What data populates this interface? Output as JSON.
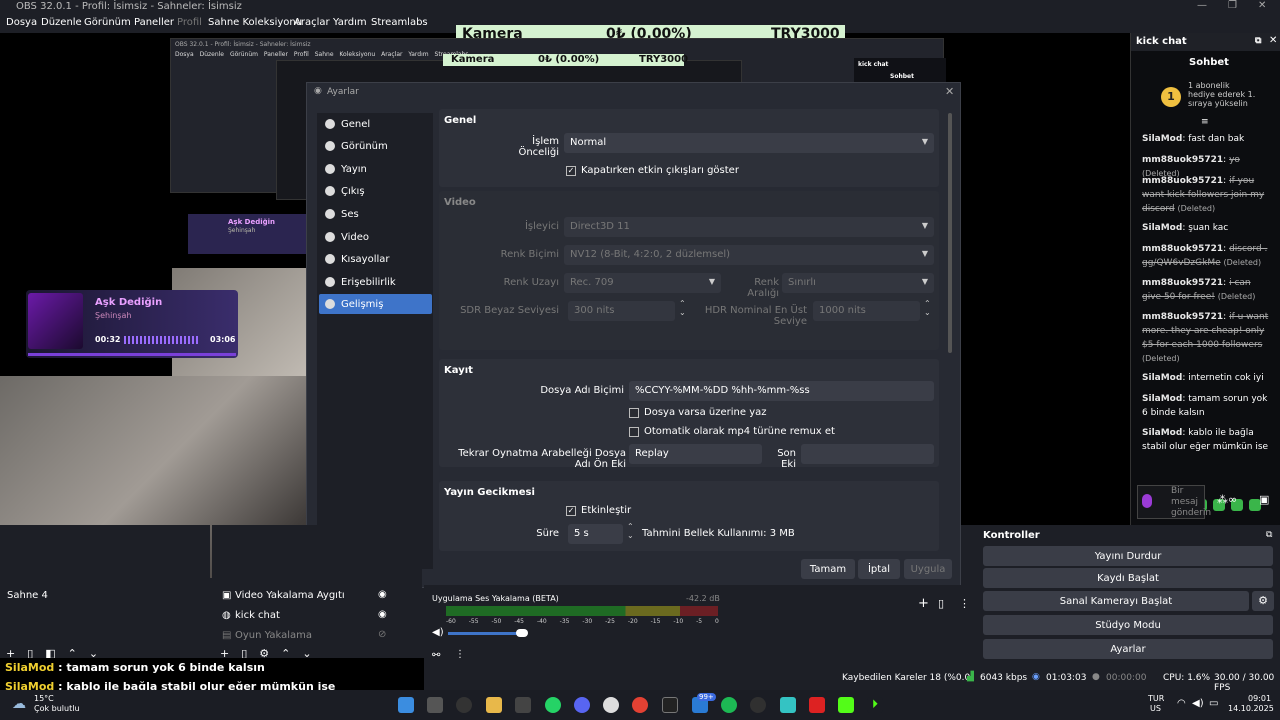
{
  "window": {
    "title": "OBS 32.0.1 - Profil: İsimsiz - Sahneler: İsimsiz",
    "minimize": "—",
    "restore": "❐",
    "close": "✕"
  },
  "menu": [
    "Dosya",
    "Düzenle",
    "Görünüm",
    "Paneller",
    "Profil",
    "Sahne Koleksiyonu",
    "Araçlar",
    "Yardım",
    "Streamlabs"
  ],
  "preview": {
    "banner_left": "Kamera",
    "banner_mid": "0₺ (0.00%)",
    "banner_right": "TRY3000",
    "inner_title": "OBS 32.0.1 - Profil: İsimsiz - Sahneler: İsimsiz",
    "inner_menu": [
      "Dosya",
      "Düzenle",
      "Görünüm",
      "Paneller",
      "Profil",
      "Sahne Koleksiyonu",
      "Araçlar",
      "Yardım",
      "Streamlabs"
    ],
    "inner_chat_title": "kick chat",
    "inner_chat_tab": "Sohbet",
    "music_title": "Aşk Dediğin",
    "music_artist": "Şehinşah",
    "music_time_start": "00:32",
    "music_time_end": "03:06"
  },
  "chat": {
    "title": "kick chat",
    "tab": "Sohbet",
    "gift": "1 abonelik hediye ederek 1. sıraya yükselin",
    "messages": [
      {
        "user": "SilaMod",
        "text": "fast dan bak",
        "deleted": false
      },
      {
        "user": "mm88uok95721",
        "text": "yo",
        "deleted": true
      },
      {
        "user": "mm88uok95721",
        "text": "if you want kick followers join my discord",
        "deleted": true
      },
      {
        "user": "SilaMod",
        "text": "şuan kac",
        "deleted": false
      },
      {
        "user": "mm88uok95721",
        "text": "discord . gg/QW6vDzGkMe",
        "deleted": true
      },
      {
        "user": "mm88uok95721",
        "text": "i can give 50 for free!",
        "deleted": true
      },
      {
        "user": "mm88uok95721",
        "text": "if u want more. they are cheap! only $5 for each 1000 followers",
        "deleted": true
      },
      {
        "user": "SilaMod",
        "text": "internetin cok iyi",
        "deleted": false
      },
      {
        "user": "SilaMod",
        "text": "tamam sorun yok 6 binde kalsın",
        "deleted": false
      },
      {
        "user": "SilaMod",
        "text": "kablo ile bağla stabil olur eğer mümkün ise",
        "deleted": false
      }
    ],
    "deleted_note": "(Deleted)",
    "input_placeholder": "Bir mesaj gönderin"
  },
  "settings": {
    "title": "Ayarlar",
    "nav": [
      "Genel",
      "Görünüm",
      "Yayın",
      "Çıkış",
      "Ses",
      "Video",
      "Kısayollar",
      "Erişebilirlik",
      "Gelişmiş"
    ],
    "selected": "Gelişmiş",
    "genel": {
      "header": "Genel",
      "priority_label": "İşlem Önceliği",
      "priority_value": "Normal",
      "show_outputs": "Kapatırken etkin çıkışları göster"
    },
    "video": {
      "header": "Video",
      "renderer_label": "İşleyici",
      "renderer_value": "Direct3D 11",
      "color_format_label": "Renk Biçimi",
      "color_format_value": "NV12 (8-Bit, 4:2:0, 2 düzlemsel)",
      "color_space_label": "Renk Uzayı",
      "color_space_value": "Rec. 709",
      "color_range_label": "Renk Aralığı",
      "color_range_value": "Sınırlı",
      "sdr_label": "SDR Beyaz Seviyesi",
      "sdr_value": "300 nits",
      "hdr_label": "HDR Nominal En Üst Seviye",
      "hdr_value": "1000 nits"
    },
    "kayit": {
      "header": "Kayıt",
      "filename_label": "Dosya Adı Biçimi",
      "filename_value": "%CCYY-%MM-%DD %hh-%mm-%ss",
      "overwrite": "Dosya varsa üzerine yaz",
      "remux": "Otomatik olarak mp4 türüne remux et",
      "replay_label": "Tekrar Oynatma Arabelleği Dosya Adı Ön Eki",
      "replay_value": "Replay",
      "suffix_label": "Son Eki"
    },
    "gecikme": {
      "header": "Yayın Gecikmesi",
      "enable": "Etkinleştir",
      "duration_label": "Süre",
      "duration_value": "5 s",
      "memory": "Tahmini Bellek Kullanımı: 3 MB"
    },
    "buttons": {
      "ok": "Tamam",
      "cancel": "İptal",
      "apply": "Uygula"
    }
  },
  "scenes": {
    "items": [
      "Sahne 4"
    ]
  },
  "sources": {
    "items": [
      "Video Yakalama Aygıtı",
      "kick chat",
      "Oyun Yakalama"
    ]
  },
  "mixer": {
    "name": "Uygulama Ses Yakalama (BETA)",
    "level": "-42.2 dB",
    "scale": [
      "-60",
      "-55",
      "-50",
      "-45",
      "-40",
      "-35",
      "-30",
      "-25",
      "-20",
      "-15",
      "-10",
      "-5",
      "0"
    ]
  },
  "controls": {
    "title": "Kontroller",
    "buttons": [
      "Yayını Durdur",
      "Kaydı Başlat",
      "Sanal Kamerayı Başlat",
      "Stüdyo Modu",
      "Ayarlar"
    ]
  },
  "status": {
    "dropped": "Kaybedilen Kareler 18 (%0.0)",
    "bitrate": "6043 kbps",
    "stream_time": "01:03:03",
    "rec_time": "00:00:00",
    "cpu": "CPU: 1.6%",
    "fps": "30.00 / 30.00 FPS"
  },
  "overlay_chat": [
    {
      "user": "SilaMod",
      "text": " : tamam sorun yok 6 binde kalsın"
    },
    {
      "user": "SilaMod",
      "text": " : kablo ile bağla stabil olur eğer mümkün ise"
    }
  ],
  "taskbar": {
    "weather_temp": "15°C",
    "weather_text": "Çok bulutlu",
    "lang": "TUR",
    "region": "US",
    "time": "09:01",
    "date": "14.10.2025",
    "badge": "99+"
  }
}
